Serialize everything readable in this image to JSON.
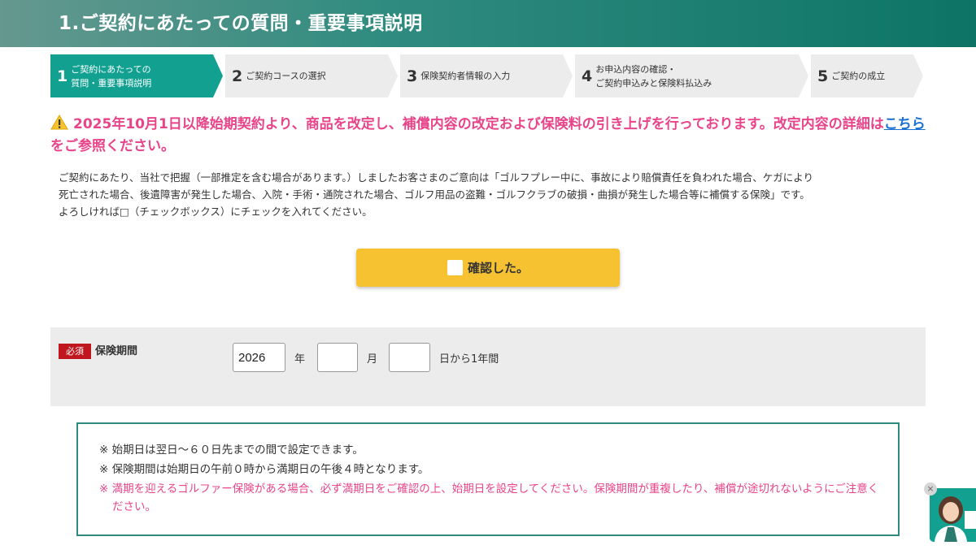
{
  "header": {
    "title": "1.ご契約にあたっての質問・重要事項説明"
  },
  "steps": [
    {
      "num": "1",
      "label": "ご契約にあたっての\n質問・重要事項説明",
      "active": true
    },
    {
      "num": "2",
      "label": "ご契約コースの選択",
      "active": false
    },
    {
      "num": "3",
      "label": "保険契約者情報の入力",
      "active": false
    },
    {
      "num": "4",
      "label": "お申込内容の確認・\nご契約申込みと保険料払込み",
      "active": false
    },
    {
      "num": "5",
      "label": "ご契約の成立",
      "active": false
    }
  ],
  "notice": {
    "text_before": "2025年10月1日以降始期契約より、商品を改定し、補償内容の改定および保険料の引き上げを行っております。改定内容の詳細は",
    "link": "こちら",
    "text_after": "をご参照ください。"
  },
  "description": {
    "line1": "ご契約にあたり、当社で把握（一部推定を含む場合があります。）しましたお客さまのご意向は「ゴルフプレー中に、事故により賠償責任を負われた場合、ケガにより",
    "line2": "死亡された場合、後遺障害が発生した場合、入院・手術・通院された場合、ゴルフ用品の盗難・ゴルフクラブの破損・曲損が発生した場合等に補償する保険」です。",
    "line3": "よろしければ□（チェックボックス）にチェックを入れてください。"
  },
  "confirm": {
    "label": "確認した。"
  },
  "period": {
    "badge": "必須",
    "label": "保険期間",
    "year_value": "2026",
    "year_unit": "年",
    "month_value": "",
    "month_unit": "月",
    "day_value": "",
    "day_unit": "日から1年間"
  },
  "notes": {
    "note1": "※ 始期日は翌日～６０日先までの間で設定できます。",
    "note2": "※ 保険期間は始期日の午前０時から満期日の午後４時となります。",
    "note3": "※ 満期を迎えるゴルファー保険がある場合、必ず満期日をご確認の上、始期日を設定してください。保険期間が重複したり、補償が途切れないようにご注意ください。"
  },
  "colors": {
    "accent_teal": "#12a191",
    "header_dark": "#0d7465",
    "notice_pink": "#e8448a",
    "link_blue": "#1a6fd1",
    "button_yellow": "#f6c232",
    "required_red": "#c0161d"
  },
  "icons": {
    "warning": "warning-icon",
    "chat_close": "close-icon",
    "operator": "operator-avatar-icon"
  },
  "chat": {
    "close": "×"
  }
}
